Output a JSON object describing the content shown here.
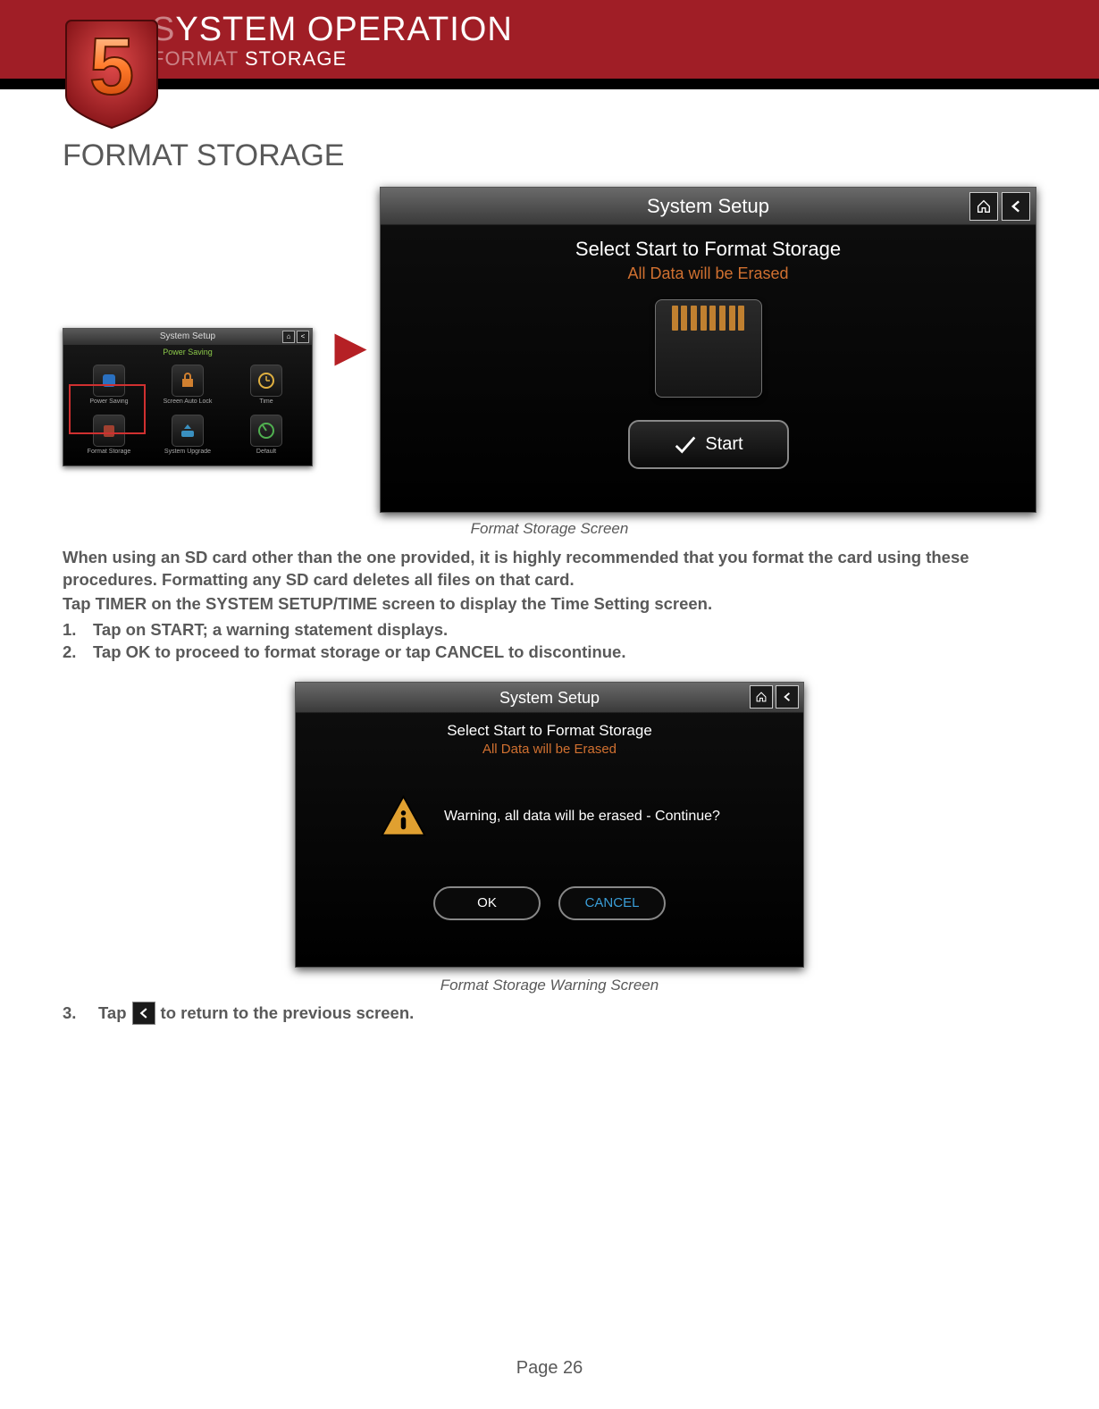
{
  "header": {
    "chapter_number": "5",
    "title_dim": "S",
    "title_plain": "YSTEM OPERATION",
    "subtitle_dim": "FORMAT ",
    "subtitle_plain": "STORAGE"
  },
  "section_title": "FORMAT STORAGE",
  "thumb": {
    "title": "System Setup",
    "subtitle": "Power Saving",
    "cells": [
      "Power Saving",
      "Screen Auto Lock",
      "Time",
      "Format Storage",
      "System Upgrade",
      "Default"
    ]
  },
  "main_screen": {
    "title": "System Setup",
    "line1": "Select Start to Format Storage",
    "line2": "All Data will be Erased",
    "start_label": "Start"
  },
  "caption1": "Format Storage Screen",
  "body": {
    "p1": "When using an SD card other than the one provided, it is highly recommended that you format the card using these procedures. Formatting any SD card deletes all files on that card.",
    "p2": "Tap TIMER on the SYSTEM SETUP/TIME  screen to display the Time Setting screen.",
    "s1": "Tap on START; a warning statement displays.",
    "s2": "Tap OK to proceed to format storage or tap CANCEL to discontinue."
  },
  "warn_screen": {
    "title": "System Setup",
    "line1": "Select Start to Format Storage",
    "line2": "All Data will be Erased",
    "msg": "Warning, all data will be erased - Continue?",
    "ok": "OK",
    "cancel": "CANCEL"
  },
  "caption2": "Format Storage Warning Screen",
  "step3_pre": "Tap ",
  "step3_post": " to return to the previous screen.",
  "footer": {
    "label": "Page ",
    "num": "26"
  }
}
